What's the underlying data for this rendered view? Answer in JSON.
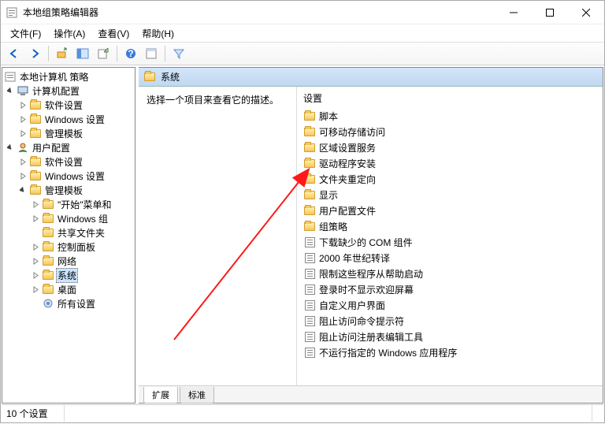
{
  "window": {
    "title": "本地组策略编辑器"
  },
  "menu": {
    "file": "文件(F)",
    "action": "操作(A)",
    "view": "查看(V)",
    "help": "帮助(H)"
  },
  "tree": {
    "root": "本地计算机 策略",
    "computer": "计算机配置",
    "c_soft": "软件设置",
    "c_win": "Windows 设置",
    "c_admin": "管理模板",
    "user": "用户配置",
    "u_soft": "软件设置",
    "u_win": "Windows 设置",
    "u_admin": "管理模板",
    "u_start": "\"开始\"菜单和",
    "u_wincomp": "Windows 组",
    "u_share": "共享文件夹",
    "u_ctrl": "控制面板",
    "u_net": "网络",
    "u_sys": "系统",
    "u_desk": "桌面",
    "u_all": "所有设置"
  },
  "header": {
    "title": "系统"
  },
  "desc": "选择一个项目来查看它的描述。",
  "settings_header": "设置",
  "items": {
    "folders": [
      "脚本",
      "可移动存储访问",
      "区域设置服务",
      "驱动程序安装",
      "文件夹重定向",
      "显示",
      "用户配置文件",
      "组策略"
    ],
    "settings": [
      "下载缺少的 COM 组件",
      "2000 年世纪转译",
      "限制这些程序从帮助启动",
      "登录时不显示欢迎屏幕",
      "自定义用户界面",
      "阻止访问命令提示符",
      "阻止访问注册表编辑工具",
      "不运行指定的 Windows 应用程序"
    ]
  },
  "tabs": {
    "extended": "扩展",
    "standard": "标准"
  },
  "status": "10 个设置"
}
